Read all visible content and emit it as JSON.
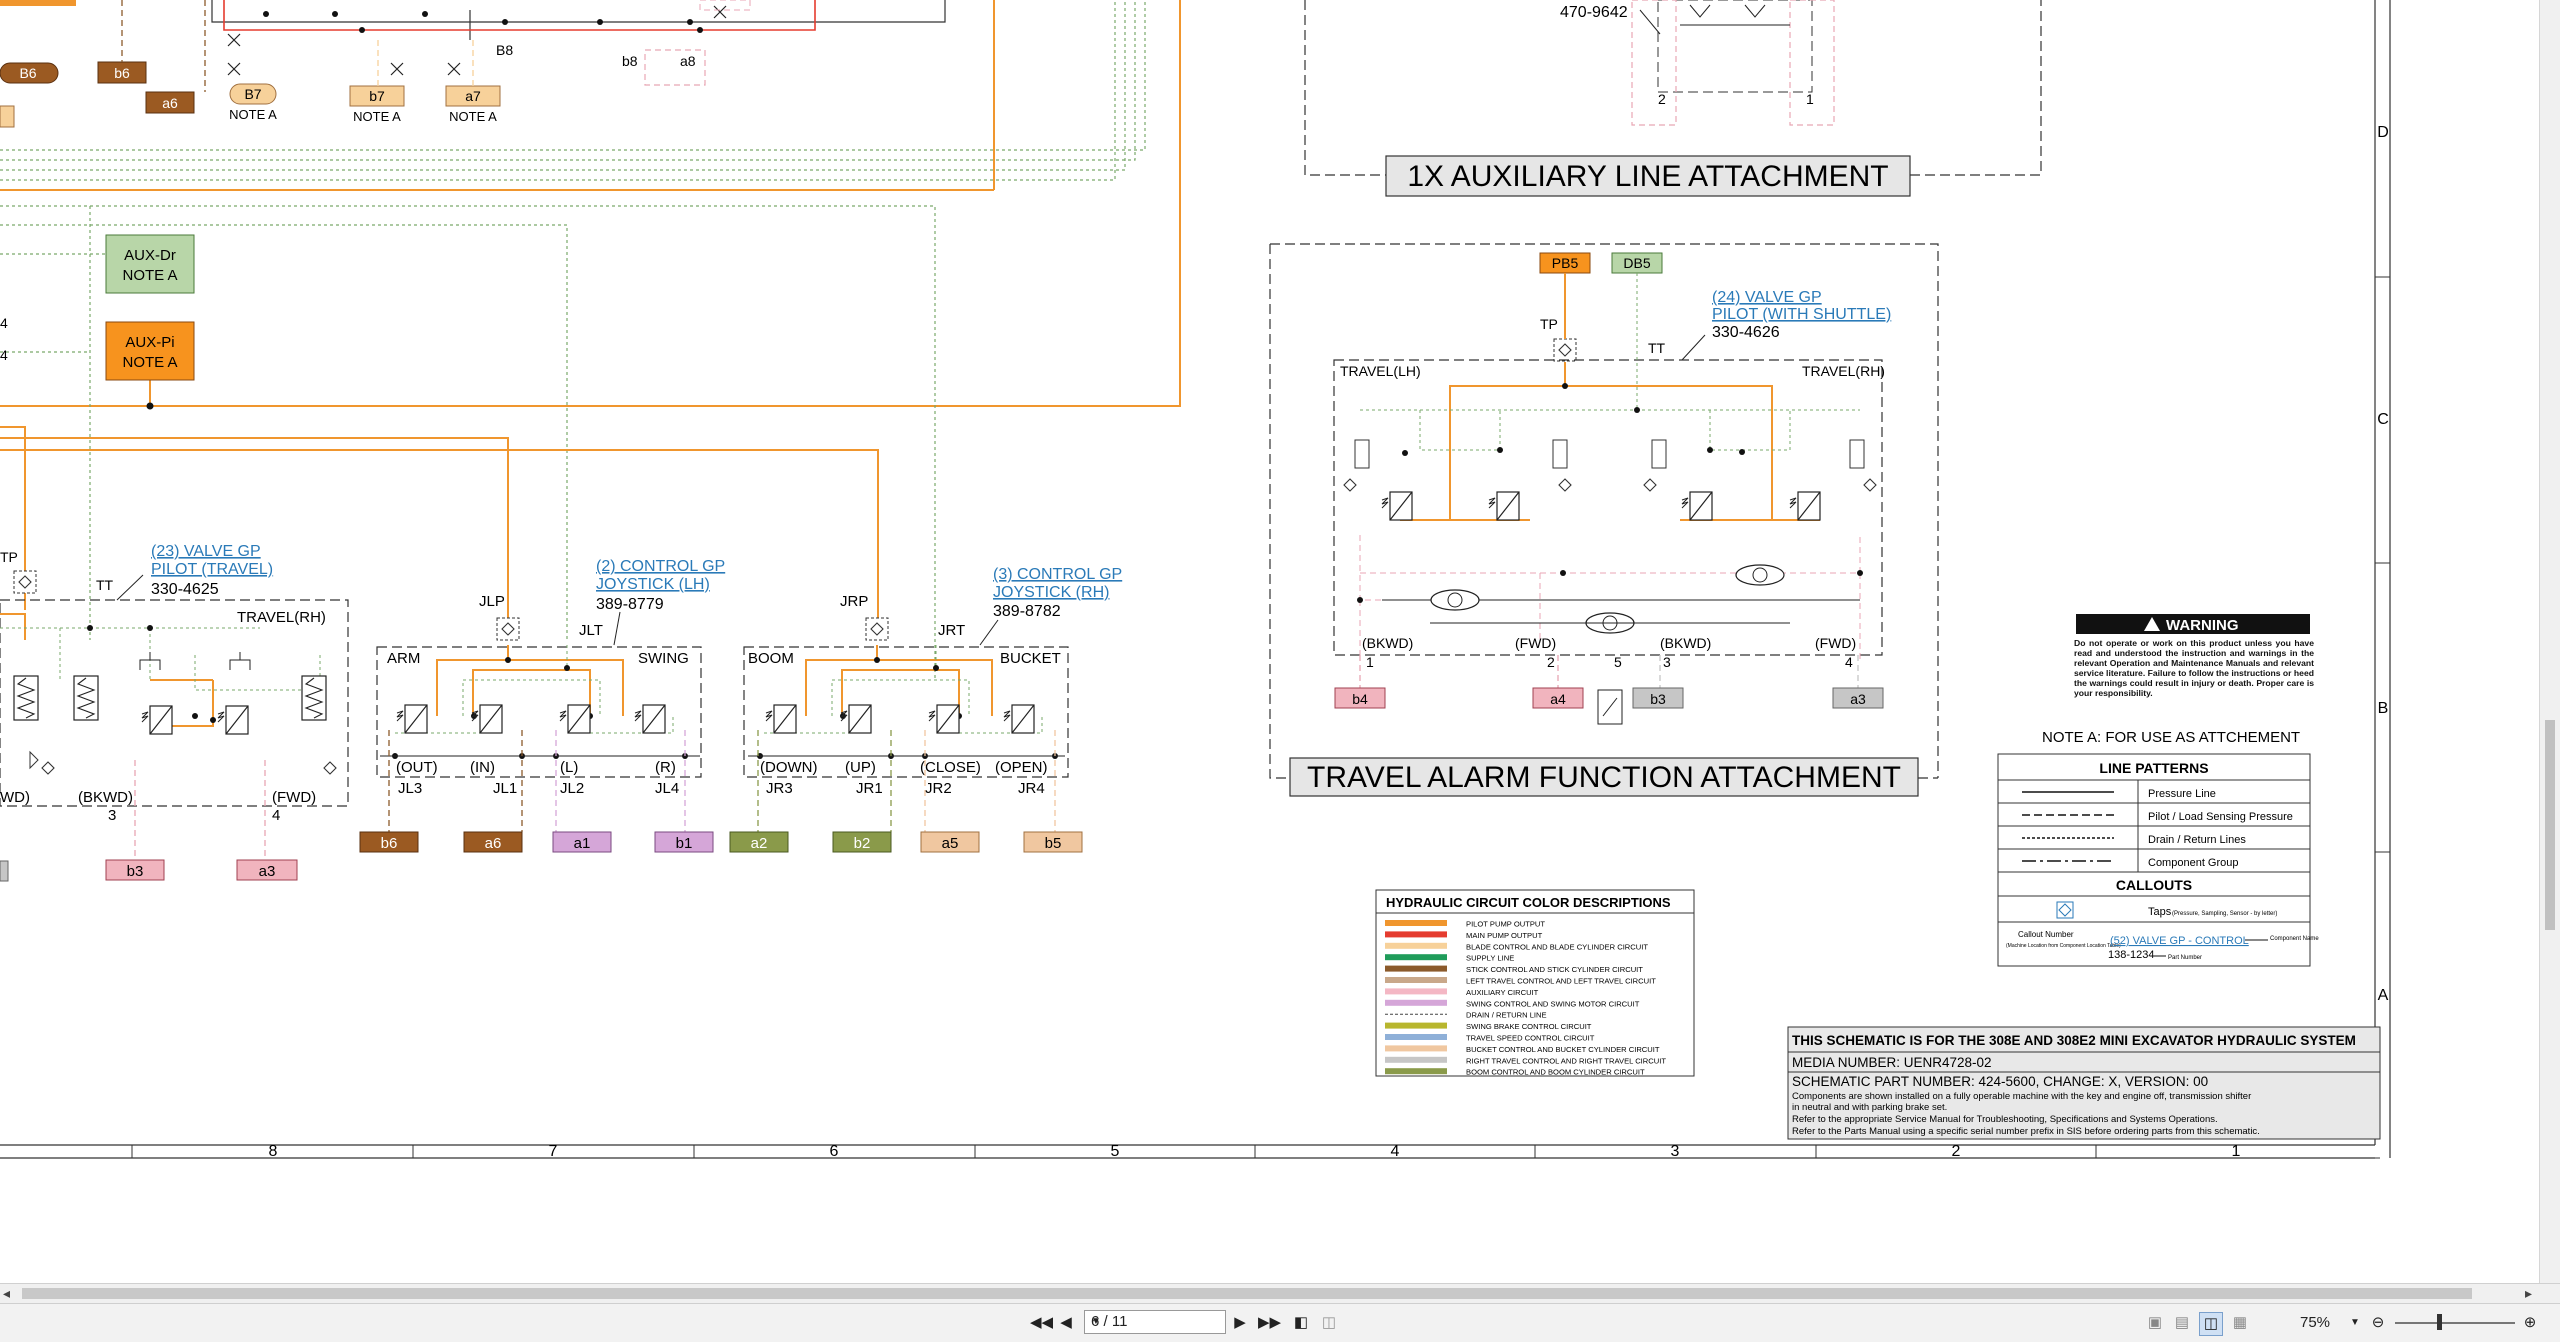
{
  "document": {
    "aux_attachment_title": "1X AUXILIARY LINE ATTACHMENT",
    "travel_alarm_title": "TRAVEL ALARM FUNCTION ATTACHMENT",
    "part_470": "470-9642",
    "top_ports": {
      "B6_oval": "B6",
      "b6": "b6",
      "a6": "a6",
      "B7": "B7",
      "b7": "b7",
      "a7": "a7",
      "note_a": "NOTE A",
      "B8": "B8",
      "b8": "b8",
      "a8": "a8"
    },
    "aux_dr": {
      "line1": "AUX-Dr",
      "line2": "NOTE A"
    },
    "aux_pi": {
      "line1": "AUX-Pi",
      "line2": "NOTE A"
    },
    "edge_labels": [
      "4",
      "4"
    ],
    "travel_valve": {
      "callout": "(23) VALVE GP",
      "callout2": "PILOT (TRAVEL)",
      "part": "330-4625",
      "tt": "TT",
      "tp": "TP",
      "travel_rh": "TRAVEL(RH)",
      "bkwd": "(BKWD)",
      "fwd": "(FWD)",
      "wd": "WD)",
      "n3": "3",
      "n4": "4",
      "b3": "b3",
      "a3": "a3"
    },
    "joystick_lh": {
      "callout": "(2) CONTROL GP",
      "callout2": "JOYSTICK (LH)",
      "part": "389-8779",
      "jlp": "JLP",
      "jlt": "JLT",
      "arm": "ARM",
      "swing": "SWING",
      "labels": [
        "(OUT)",
        "(IN)",
        "(L)",
        "(R)"
      ],
      "ports": [
        "JL3",
        "JL1",
        "JL2",
        "JL4"
      ],
      "boxes": [
        "b6",
        "a6",
        "a1",
        "b1"
      ]
    },
    "joystick_rh": {
      "callout": "(3) CONTROL GP",
      "callout2": "JOYSTICK (RH)",
      "part": "389-8782",
      "jrp": "JRP",
      "jrt": "JRT",
      "boom": "BOOM",
      "bucket": "BUCKET",
      "labels": [
        "(DOWN)",
        "(UP)",
        "(CLOSE)",
        "(OPEN)"
      ],
      "ports": [
        "JR3",
        "JR1",
        "JR2",
        "JR4"
      ],
      "boxes": [
        "a2",
        "b2",
        "a5",
        "b5"
      ]
    },
    "travel_alarm": {
      "pb5": "PB5",
      "db5": "DB5",
      "callout": "(24) VALVE GP",
      "callout2": "PILOT (WITH SHUTTLE)",
      "part": "330-4626",
      "tp": "TP",
      "tt": "TT",
      "travel_lh": "TRAVEL(LH)",
      "travel_rh": "TRAVEL(RH)",
      "bottom_labels": [
        "(BKWD)",
        "(FWD)",
        "(BKWD)",
        "(FWD)"
      ],
      "numbers": [
        "1",
        "2",
        "5",
        "3",
        "4"
      ],
      "boxes": [
        "b4",
        "a4",
        "b3",
        "a3"
      ]
    },
    "warning": {
      "title": "WARNING",
      "text": "Do not operate or work on this product unless you have read and understood the instruction and warnings in the relevant Operation and Maintenance Manuals and relevant service literature. Failure to follow the instructions or heed the warnings could result in injury or death. Proper care is your responsibility."
    },
    "note_a": "NOTE A: FOR USE AS ATTCHEMENT",
    "line_patterns": {
      "title": "LINE PATTERNS",
      "rows": [
        "Pressure Line",
        "Pilot / Load Sensing Pressure",
        "Drain / Return Lines",
        "Component Group"
      ],
      "callouts_title": "CALLOUTS",
      "taps": "Taps",
      "taps_small": "(Pressure, Sampling, Sensor - by letter)",
      "callout_number": "Callout Number",
      "callout_number_small": "(Machine Location from Component Location Table)",
      "component_name": "Component Name",
      "example_link": "(52) VALVE GP - CONTROL",
      "example_part": "138-1234",
      "part_number": "Part Number"
    },
    "color_desc": {
      "title": "HYDRAULIC CIRCUIT COLOR DESCRIPTIONS",
      "rows": [
        {
          "label": "PILOT PUMP OUTPUT",
          "color": "#f0962e"
        },
        {
          "label": "MAIN PUMP OUTPUT",
          "color": "#e53c2f"
        },
        {
          "label": "BLADE CONTROL AND BLADE CYLINDER CIRCUIT",
          "color": "#f7d19a"
        },
        {
          "label": "SUPPLY LINE",
          "color": "#1f9c5a"
        },
        {
          "label": "STICK CONTROL AND STICK CYLINDER CIRCUIT",
          "color": "#8b5a2b"
        },
        {
          "label": "LEFT TRAVEL CONTROL AND LEFT TRAVEL CIRCUIT",
          "color": "#c9a88a"
        },
        {
          "label": "AUXILIARY CIRCUIT",
          "color": "#f4b7c4"
        },
        {
          "label": "SWING CONTROL AND SWING MOTOR CIRCUIT",
          "color": "#d5a6d8"
        },
        {
          "label": "DRAIN / RETURN LINE",
          "color": "#7aa96b"
        },
        {
          "label": "SWING BRAKE CONTROL CIRCUIT",
          "color": "#b8b62e"
        },
        {
          "label": "TRAVEL SPEED CONTROL CIRCUIT",
          "color": "#8fb0d8"
        },
        {
          "label": "BUCKET CONTROL AND BUCKET CYLINDER CIRCUIT",
          "color": "#f0c7a0"
        },
        {
          "label": "RIGHT TRAVEL CONTROL AND RIGHT TRAVEL CIRCUIT",
          "color": "#c6c6c6"
        },
        {
          "label": "BOOM CONTROL AND BOOM CYLINDER CIRCUIT",
          "color": "#8a9a4a"
        }
      ]
    },
    "title_block": {
      "line1": "THIS SCHEMATIC IS FOR THE 308E AND 308E2 MINI EXCAVATOR HYDRAULIC SYSTEM",
      "media": "MEDIA NUMBER: UENR4728-02",
      "part": "SCHEMATIC PART NUMBER: 424-5600, CHANGE: X, VERSION: 00",
      "notes": [
        "Components are shown installed on a fully operable machine with the key and engine off, transmission shifter",
        "in neutral and with parking brake set.",
        "Refer to the appropriate Service Manual for Troubleshooting, Specifications and Systems Operations.",
        "Refer to the Parts Manual using a specific serial number prefix in SIS before ordering parts from this schematic."
      ]
    },
    "grid_columns": [
      "8",
      "7",
      "6",
      "5",
      "4",
      "3",
      "2",
      "1"
    ],
    "grid_rows": [
      "D",
      "C",
      "B",
      "A"
    ]
  },
  "viewer": {
    "page_value": "6 / 11",
    "zoom_value": "75%",
    "first_page_icon": "first-page-icon",
    "prev_page_icon": "prev-page-icon",
    "next_page_icon": "next-page-icon",
    "last_page_icon": "last-page-icon"
  },
  "colors": {
    "pilot": "#f0962e",
    "drain": "#7aa96b",
    "pink": "#e8a6b4",
    "red": "#e53c2f"
  }
}
